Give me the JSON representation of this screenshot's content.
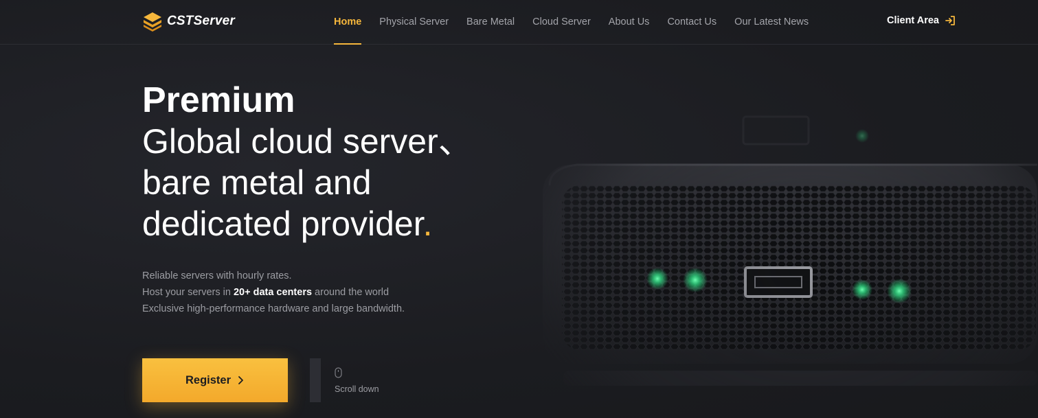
{
  "brand": {
    "name": "CSTServer",
    "accent": "#f6b73c"
  },
  "nav": {
    "items": [
      {
        "label": "Home",
        "active": true
      },
      {
        "label": "Physical Server",
        "active": false
      },
      {
        "label": "Bare Metal",
        "active": false
      },
      {
        "label": "Cloud Server",
        "active": false
      },
      {
        "label": "About Us",
        "active": false
      },
      {
        "label": "Contact Us",
        "active": false
      },
      {
        "label": "Our Latest News",
        "active": false
      }
    ],
    "client_area": "Client Area",
    "client_icon": "sign-in-icon"
  },
  "hero": {
    "line1": "Premium",
    "line2": "Global cloud server、",
    "line3": "bare metal and",
    "line4": "dedicated provider",
    "period": ".",
    "desc1": "Reliable servers with hourly rates.",
    "desc2_pre": "Host your servers in ",
    "desc2_bold": "20+ data centers",
    "desc2_post": " around the world",
    "desc3": "Exclusive high-performance hardware and large bandwidth."
  },
  "cta": {
    "register": "Register",
    "register_icon": "chevron-right-icon",
    "scroll": "Scroll down",
    "scroll_icon": "mouse-icon"
  }
}
